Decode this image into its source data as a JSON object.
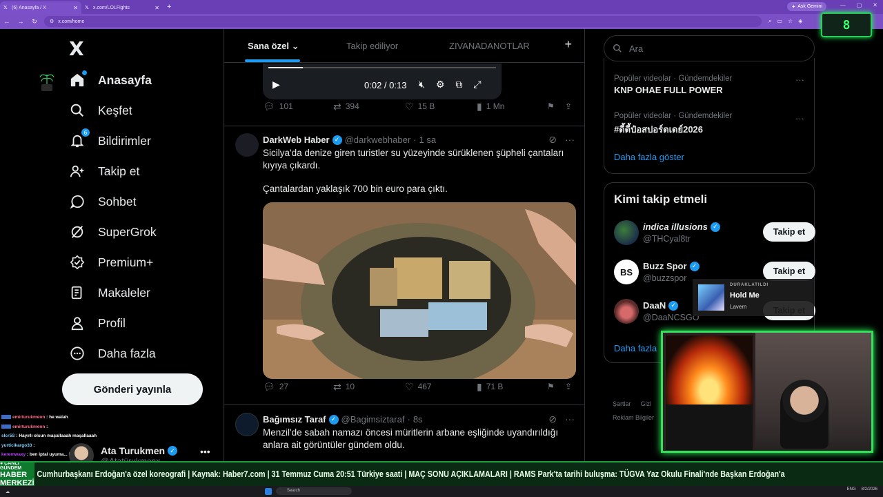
{
  "browser": {
    "tabs": [
      {
        "title": "(6) Anasayfa / X"
      },
      {
        "title": "x.com/LOLFights"
      }
    ],
    "url": "x.com/home",
    "ask_gemini": "Ask Gemini"
  },
  "overlay_counter": "8",
  "sidebar": {
    "logo": "X",
    "items": [
      {
        "label": "Anasayfa",
        "icon": "home-icon"
      },
      {
        "label": "Keşfet",
        "icon": "search-icon"
      },
      {
        "label": "Bildirimler",
        "icon": "bell-icon",
        "badge": "6"
      },
      {
        "label": "Takip et",
        "icon": "add-user-icon"
      },
      {
        "label": "Sohbet",
        "icon": "chat-icon"
      },
      {
        "label": "SuperGrok",
        "icon": "grok-icon"
      },
      {
        "label": "Premium+",
        "icon": "premium-icon"
      },
      {
        "label": "Makaleler",
        "icon": "articles-icon"
      },
      {
        "label": "Profil",
        "icon": "user-icon"
      },
      {
        "label": "Daha fazla",
        "icon": "more-circle-icon"
      }
    ],
    "post_button": "Gönderi yayınla",
    "profile": {
      "name": "Ata Turukmen",
      "handle": "@Atatürukmenx"
    }
  },
  "chat": [
    {
      "user": "emirturukmenn",
      "text": ": he walah"
    },
    {
      "user": "emirturukmenn",
      "text": ":"
    },
    {
      "user": "slcr5S",
      "text": ": Hayırlı olsun maşallaaah maşallaaah"
    },
    {
      "user": "yurticikargo33",
      "text": ":"
    },
    {
      "user": "keremwaxy",
      "text": ": ben iptal uyuma... iyi yayınlar"
    }
  ],
  "feed": {
    "tabs": [
      "Sana özel",
      "Takip ediliyor",
      "ZIVANADANOTLAR"
    ],
    "video": {
      "time": "0:02 / 0:13",
      "progress": 0.15
    },
    "tweet0_actions": {
      "reply": "101",
      "retweet": "394",
      "like": "15 B",
      "views": "1 Mn"
    },
    "tweets": [
      {
        "name": "DarkWeb Haber",
        "handle": "@darkwebhaber",
        "time": "1 sa",
        "text1": "Sicilya'da denize giren turistler su yüzeyinde sürüklenen şüpheli çantaları kıyıya çıkardı.",
        "text2": "Çantalardan yaklaşık 700 bin euro para çıktı.",
        "reply": "27",
        "retweet": "10",
        "like": "467",
        "views": "71 B"
      },
      {
        "name": "Bağımsız Taraf",
        "handle": "@Bagimsiztaraf",
        "time": "8s",
        "text1": "Menzil'de sabah namazı öncesi müritlerin arbane eşliğinde uyandırıldığı anlara ait görüntüler gündem oldu."
      }
    ]
  },
  "right": {
    "search_placeholder": "Ara",
    "trends": [
      {
        "category": "Popüler videolar · Gündemdekiler",
        "name": "KNP OHAE FULL POWER"
      },
      {
        "category": "Popüler videolar · Gündemdekiler",
        "name": "#ดี้ดี้ป๋อสปอร์ตเดย์2026"
      }
    ],
    "show_more": "Daha fazla göster",
    "who_to_follow_title": "Kimi takip etmeli",
    "who_to_follow": [
      {
        "name": "indica illusions",
        "handle": "@THCyal8tr"
      },
      {
        "name": "Buzz Spor",
        "handle": "@buzzspor"
      },
      {
        "name": "DaaN",
        "handle": "@DaaNCSGO"
      }
    ],
    "follow_label": "Takip et",
    "wtf_more": "Daha fazla",
    "footer": [
      "Şartlar",
      "Gizl"
    ],
    "footer2": "Reklam Bilgiler"
  },
  "now_playing": {
    "tag": "DURAKLATILDI",
    "title": "Hold Me",
    "artist": "Lavern"
  },
  "ticker": {
    "label_top": "● CANLI GÜNDEM",
    "label_bottom": "HABER MERKEZİ",
    "text": "Cumhurbaşkanı Erdoğan'a özel koreografi | Kaynak: Haber7.com | 31 Temmuz Cuma 20:51 Türkiye saati | MAÇ SONU AÇIKLAMALARI | RAMS Park'ta tarihi buluşma: TÜGVA Yaz Okulu Finali'nde Başkan Erdoğan'a"
  },
  "taskbar": {
    "search": "Search",
    "lang": "ENG",
    "date": "8/2/2026"
  },
  "colors": {
    "accent": "#1d9bf0",
    "browser": "#7b4fc6",
    "ticker": "#0e7a2d",
    "overlay_green": "#36e05c"
  }
}
